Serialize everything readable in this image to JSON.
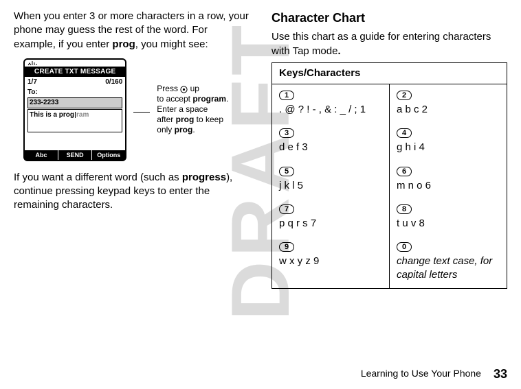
{
  "watermark": "DRAFT",
  "left": {
    "intro_before": "When you enter 3 or more characters in a row, your phone may guess the rest of the word. For example, if you enter ",
    "intro_code": "prog",
    "intro_after": ", you might see:",
    "phone": {
      "title": "CREATE TXT MESSAGE",
      "counter_left": "1/7",
      "counter_right": "0/160",
      "to_label": "To:",
      "to_value": "233-2233",
      "msg_prefix": "This is a prog",
      "msg_suggest": "ram",
      "soft_left": "Abc",
      "soft_mid": "SEND",
      "soft_right": "Options"
    },
    "callout": {
      "l1a": "Press ",
      "l1b": " up",
      "l2a": "to accept ",
      "l2b": "program",
      "l2c": ".",
      "l3": "Enter a space",
      "l4a": "after ",
      "l4b": "prog",
      "l4c": " to keep",
      "l5a": "only ",
      "l5b": "prog",
      "l5c": "."
    },
    "outro_before": "If you want a different word (such as ",
    "outro_code": "progress",
    "outro_after": "), continue pressing keypad keys to enter the remaining characters."
  },
  "right": {
    "heading": "Character Chart",
    "lead_before": "Use this chart as a guide for entering characters with Tap mode",
    "lead_dot": ".",
    "header": "Keys/Characters",
    "rows": [
      {
        "k1": "1",
        "v1": ". @ ? ! - , & : _ / ; 1",
        "k2": "2",
        "v2": "a b c 2"
      },
      {
        "k1": "3",
        "v1": "d e f 3",
        "k2": "4",
        "v2": "g h i 4"
      },
      {
        "k1": "5",
        "v1": "j k l 5",
        "k2": "6",
        "v2": "m n o 6"
      },
      {
        "k1": "7",
        "v1": "p q r s 7",
        "k2": "8",
        "v2": "t u v 8"
      },
      {
        "k1": "9",
        "v1": "w x y z 9",
        "k2": "0",
        "v2": "change text case, for capital letters"
      }
    ]
  },
  "footer": {
    "section": "Learning to Use Your Phone",
    "page": "33"
  }
}
